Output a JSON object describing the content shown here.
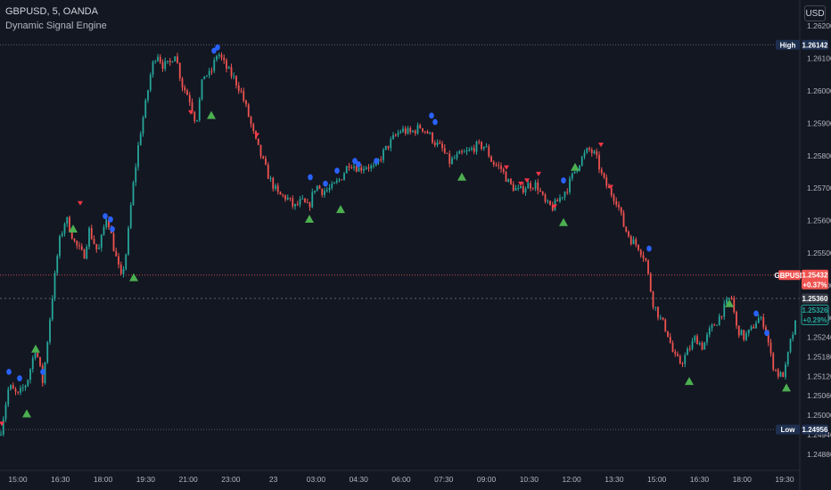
{
  "header": {
    "symbol_line": "GBPUSD, 5, OANDA",
    "indicator_name": "Dynamic Signal Engine"
  },
  "currency_button": "USD",
  "colors": {
    "background": "#131722",
    "up": "#26a69a",
    "down": "#ef5350",
    "buy_signal": "#4caf50",
    "sell_signal": "#f23645",
    "dot_signal": "#2962ff",
    "high_low_tag": "#1e2f4f"
  },
  "chart_data": {
    "type": "candlestick",
    "ylim": [
      1.2483,
      1.2628
    ],
    "yticks": [
      "1.26200",
      "1.26100",
      "1.26000",
      "1.25900",
      "1.25800",
      "1.25700",
      "1.25600",
      "1.25500",
      "1.25400",
      "1.25300",
      "1.25240",
      "1.25180",
      "1.25120",
      "1.25060",
      "1.25000",
      "1.24940",
      "1.24880"
    ],
    "x_tick_labels": [
      "15:00",
      "16:30",
      "18:00",
      "19:30",
      "21:00",
      "23:00",
      "23",
      "03:00",
      "04:30",
      "06:00",
      "07:30",
      "09:00",
      "10:30",
      "12:00",
      "13:30",
      "15:00",
      "16:30",
      "18:00",
      "19:30"
    ],
    "grid": false,
    "price_path": [
      [
        0,
        1.2494
      ],
      [
        10,
        1.2509
      ],
      [
        20,
        1.2506
      ],
      [
        30,
        1.251
      ],
      [
        40,
        1.2521
      ],
      [
        48,
        1.251
      ],
      [
        58,
        1.2535
      ],
      [
        66,
        1.2553
      ],
      [
        74,
        1.2561
      ],
      [
        84,
        1.2553
      ],
      [
        94,
        1.2549
      ],
      [
        100,
        1.2557
      ],
      [
        110,
        1.255
      ],
      [
        120,
        1.2562
      ],
      [
        128,
        1.2551
      ],
      [
        136,
        1.2542
      ],
      [
        142,
        1.2551
      ],
      [
        148,
        1.2568
      ],
      [
        156,
        1.2585
      ],
      [
        164,
        1.2597
      ],
      [
        170,
        1.2607
      ],
      [
        176,
        1.2612
      ],
      [
        182,
        1.2608
      ],
      [
        190,
        1.2608
      ],
      [
        196,
        1.2612
      ],
      [
        204,
        1.2602
      ],
      [
        212,
        1.2598
      ],
      [
        220,
        1.259
      ],
      [
        228,
        1.2605
      ],
      [
        236,
        1.2605
      ],
      [
        244,
        1.2612
      ],
      [
        254,
        1.2607
      ],
      [
        262,
        1.2604
      ],
      [
        270,
        1.26
      ],
      [
        278,
        1.2593
      ],
      [
        286,
        1.2585
      ],
      [
        294,
        1.2579
      ],
      [
        302,
        1.2573
      ],
      [
        312,
        1.2568
      ],
      [
        322,
        1.2567
      ],
      [
        330,
        1.2564
      ],
      [
        338,
        1.2566
      ],
      [
        346,
        1.2564
      ],
      [
        354,
        1.2571
      ],
      [
        362,
        1.2569
      ],
      [
        372,
        1.257
      ],
      [
        382,
        1.2573
      ],
      [
        392,
        1.2578
      ],
      [
        402,
        1.2576
      ],
      [
        412,
        1.2577
      ],
      [
        420,
        1.2576
      ],
      [
        430,
        1.2581
      ],
      [
        440,
        1.2585
      ],
      [
        450,
        1.2588
      ],
      [
        460,
        1.2587
      ],
      [
        472,
        1.2589
      ],
      [
        480,
        1.2587
      ],
      [
        488,
        1.2584
      ],
      [
        496,
        1.2582
      ],
      [
        504,
        1.2578
      ],
      [
        514,
        1.258
      ],
      [
        524,
        1.2581
      ],
      [
        534,
        1.2583
      ],
      [
        544,
        1.2583
      ],
      [
        552,
        1.2578
      ],
      [
        562,
        1.2576
      ],
      [
        572,
        1.2571
      ],
      [
        582,
        1.2569
      ],
      [
        592,
        1.2571
      ],
      [
        602,
        1.2571
      ],
      [
        612,
        1.2565
      ],
      [
        620,
        1.2564
      ],
      [
        628,
        1.2567
      ],
      [
        636,
        1.257
      ],
      [
        644,
        1.2575
      ],
      [
        652,
        1.2579
      ],
      [
        660,
        1.2582
      ],
      [
        668,
        1.258
      ],
      [
        676,
        1.2573
      ],
      [
        684,
        1.2569
      ],
      [
        692,
        1.2566
      ],
      [
        700,
        1.2558
      ],
      [
        708,
        1.2554
      ],
      [
        716,
        1.2552
      ],
      [
        724,
        1.2548
      ],
      [
        732,
        1.2535
      ],
      [
        740,
        1.253
      ],
      [
        748,
        1.2526
      ],
      [
        756,
        1.2518
      ],
      [
        764,
        1.2516
      ],
      [
        772,
        1.252
      ],
      [
        780,
        1.2524
      ],
      [
        788,
        1.2521
      ],
      [
        796,
        1.2526
      ],
      [
        804,
        1.2529
      ],
      [
        812,
        1.2533
      ],
      [
        820,
        1.2537
      ],
      [
        826,
        1.2527
      ],
      [
        834,
        1.2524
      ],
      [
        842,
        1.2526
      ],
      [
        850,
        1.253
      ],
      [
        858,
        1.2528
      ],
      [
        866,
        1.2516
      ],
      [
        874,
        1.2512
      ],
      [
        880,
        1.2513
      ],
      [
        886,
        1.2522
      ],
      [
        893,
        1.2529
      ]
    ],
    "buy_signals": [
      [
        30,
        1.2504
      ],
      [
        40,
        1.2524
      ],
      [
        82,
        1.2561
      ],
      [
        150,
        1.2546
      ],
      [
        237,
        1.2596
      ],
      [
        347,
        1.2564
      ],
      [
        382,
        1.2567
      ],
      [
        518,
        1.2577
      ],
      [
        632,
        1.2563
      ],
      [
        645,
        1.258
      ],
      [
        773,
        1.2514
      ],
      [
        818,
        1.2538
      ],
      [
        882,
        1.2512
      ]
    ],
    "sell_signals": [
      [
        2,
        1.2495
      ],
      [
        90,
        1.2563
      ],
      [
        214,
        1.2591
      ],
      [
        288,
        1.2584
      ],
      [
        568,
        1.2574
      ],
      [
        584,
        1.2569
      ],
      [
        591,
        1.257
      ],
      [
        604,
        1.2572
      ],
      [
        622,
        1.2562
      ],
      [
        674,
        1.2581
      ],
      [
        685,
        1.2568
      ]
    ],
    "dot_signals": [
      [
        10,
        1.2512
      ],
      [
        22,
        1.251
      ],
      [
        48,
        1.2512
      ],
      [
        118,
        1.256
      ],
      [
        124,
        1.2559
      ],
      [
        126,
        1.2556
      ],
      [
        240,
        1.2611
      ],
      [
        244,
        1.2612
      ],
      [
        348,
        1.2572
      ],
      [
        365,
        1.257
      ],
      [
        378,
        1.2574
      ],
      [
        398,
        1.2577
      ],
      [
        402,
        1.2576
      ],
      [
        422,
        1.2577
      ],
      [
        484,
        1.2591
      ],
      [
        488,
        1.2589
      ],
      [
        632,
        1.2571
      ],
      [
        728,
        1.255
      ],
      [
        848,
        1.253
      ],
      [
        860,
        1.2524
      ]
    ],
    "high": {
      "label": "High",
      "value": "1.26142",
      "y": 1.26142
    },
    "low": {
      "label": "Low",
      "value": "1.24956",
      "y": 1.24956
    },
    "current": {
      "label": "GBPUSD",
      "value": "1.25432",
      "change": "+0.37%",
      "y": 1.25432
    },
    "crosshair": {
      "value": "1.25360",
      "y": 1.2536
    },
    "session": {
      "value": "1.25326",
      "change": "+0.29%",
      "y": 1.25326
    }
  }
}
